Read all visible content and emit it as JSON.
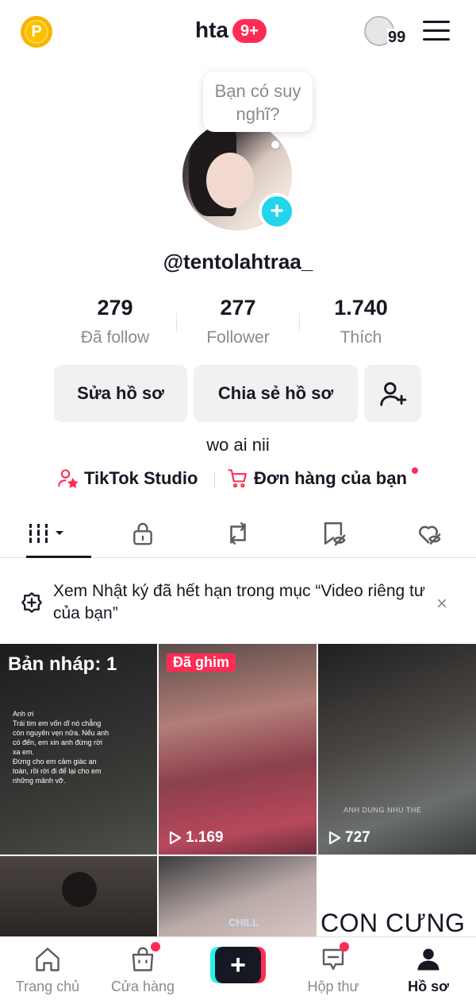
{
  "header": {
    "coin_letter": "P",
    "username": "hta",
    "notifications_badge": "9+",
    "friends_count": "99"
  },
  "profile": {
    "thought_bubble": "Bạn có suy nghĩ?",
    "add_avatar_symbol": "+",
    "handle": "@tentolahtraa_",
    "stats": [
      {
        "value": "279",
        "label": "Đã follow"
      },
      {
        "value": "277",
        "label": "Follower"
      },
      {
        "value": "1.740",
        "label": "Thích"
      }
    ],
    "edit_button": "Sửa hồ sơ",
    "share_button": "Chia sẻ hồ sơ",
    "bio": "wo ai nii",
    "studio_link": "TikTok Studio",
    "orders_link": "Đơn hàng của bạn"
  },
  "tabs": [
    {
      "icon": "grid-icon",
      "active": true
    },
    {
      "icon": "lock-icon",
      "active": false
    },
    {
      "icon": "repost-icon",
      "active": false
    },
    {
      "icon": "bookmark-hidden-icon",
      "active": false
    },
    {
      "icon": "liked-hidden-icon",
      "active": false
    }
  ],
  "notice": {
    "text": "Xem Nhật ký đã hết hạn trong mục “Video riêng tư của bạn”",
    "close": "×"
  },
  "videos": [
    {
      "type": "draft",
      "label": "Bản nháp: 1",
      "caption": "Anh ơi\nTrái tim em vốn dĩ nó chẳng còn nguyên vẹn nữa. Nếu anh có đến, em xin anh đừng rời xa em.\nĐừng cho em cảm giác an toàn, rồi rời đi để lại cho em những mảnh vỡ."
    },
    {
      "type": "pinned",
      "badge": "Đã ghim",
      "views": "1.169"
    },
    {
      "type": "normal",
      "views": "727",
      "caption": "ANH DUNG NHU THE"
    },
    {
      "type": "normal"
    },
    {
      "type": "normal",
      "caption": "CHILL"
    },
    {
      "type": "text",
      "caption": "CON CƯNG"
    }
  ],
  "bottom_nav": [
    {
      "label": "Trang chủ",
      "icon": "home-icon"
    },
    {
      "label": "Cửa hàng",
      "icon": "shop-icon",
      "dot": true
    },
    {
      "label": "",
      "icon": "create-icon",
      "symbol": "+"
    },
    {
      "label": "Hộp thư",
      "icon": "inbox-icon",
      "dot": true
    },
    {
      "label": "Hồ sơ",
      "icon": "profile-icon",
      "active": true
    }
  ],
  "colors": {
    "accent": "#fe2c55",
    "cyan": "#20d5ec",
    "text": "#161823",
    "muted": "#8a8b91",
    "button_bg": "#f1f1f2"
  }
}
